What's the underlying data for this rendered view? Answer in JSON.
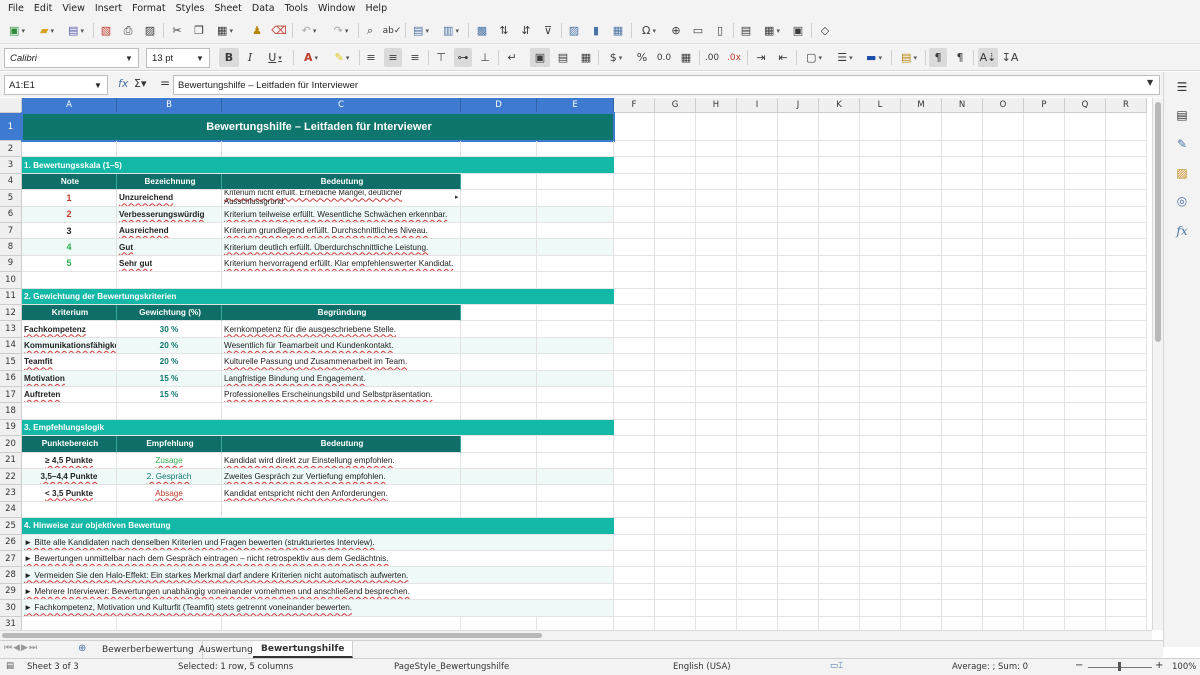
{
  "menu": [
    "File",
    "Edit",
    "View",
    "Insert",
    "Format",
    "Styles",
    "Sheet",
    "Data",
    "Tools",
    "Window",
    "Help"
  ],
  "font": {
    "name": "Calibri",
    "size": "13 pt"
  },
  "namebox": "A1:E1",
  "formula": "Bewertungshilfe – Leitfaden für Interviewer",
  "columns": [
    "A",
    "B",
    "C",
    "D",
    "E",
    "F",
    "G",
    "H",
    "I",
    "J",
    "K",
    "L",
    "M",
    "N",
    "O",
    "P",
    "Q",
    "R"
  ],
  "rows": [
    "1",
    "2",
    "3",
    "4",
    "5",
    "6",
    "7",
    "8",
    "9",
    "10",
    "11",
    "12",
    "13",
    "14",
    "15",
    "16",
    "17",
    "18",
    "19",
    "20",
    "21",
    "22",
    "23",
    "24",
    "25",
    "26",
    "27",
    "28",
    "29",
    "30",
    "31"
  ],
  "sheet": {
    "title": "Bewertungshilfe – Leitfaden für Interviewer",
    "s1": {
      "header": "1. Bewertungsskala (1–5)",
      "cols": [
        "Note",
        "Bezeichnung",
        "Bedeutung"
      ],
      "rows": [
        {
          "note": "1",
          "label": "Unzureichend",
          "desc": "Kriterium nicht erfüllt. Erhebliche Mängel, deutlicher Ausschlussgrund.",
          "color": "#c0392b"
        },
        {
          "note": "2",
          "label": "Verbesserungswürdig",
          "desc": "Kriterium teilweise erfüllt. Wesentliche Schwächen erkennbar.",
          "color": "#c0392b"
        },
        {
          "note": "3",
          "label": "Ausreichend",
          "desc": "Kriterium grundlegend erfüllt. Durchschnittliches Niveau.",
          "color": "#222222"
        },
        {
          "note": "4",
          "label": "Gut",
          "desc": "Kriterium deutlich erfüllt. Überdurchschnittliche Leistung.",
          "color": "#2fae4e"
        },
        {
          "note": "5",
          "label": "Sehr gut",
          "desc": "Kriterium hervorragend erfüllt. Klar empfehlenswerter Kandidat.",
          "color": "#2fae4e"
        }
      ]
    },
    "s2": {
      "header": "2. Gewichtung der Bewertungskriterien",
      "cols": [
        "Kriterium",
        "Gewichtung (%)",
        "Begründung"
      ],
      "rows": [
        {
          "k": "Fachkompetenz",
          "w": "30 %",
          "b": "Kernkompetenz für die ausgeschriebene Stelle."
        },
        {
          "k": "Kommunikationsfähigkeit",
          "w": "20 %",
          "b": "Wesentlich für Teamarbeit und Kundenkontakt."
        },
        {
          "k": "Teamfit",
          "w": "20 %",
          "b": "Kulturelle Passung und Zusammenarbeit im Team."
        },
        {
          "k": "Motivation",
          "w": "15 %",
          "b": "Langfristige Bindung und Engagement."
        },
        {
          "k": "Auftreten",
          "w": "15 %",
          "b": "Professionelles Erscheinungsbild und Selbstpräsentation."
        }
      ]
    },
    "s3": {
      "header": "3. Empfehlungslogik",
      "cols": [
        "Punktebereich",
        "Empfehlung",
        "Bedeutung"
      ],
      "rows": [
        {
          "p": "≥ 4,5 Punkte",
          "e": "Zusage",
          "b": "Kandidat wird direkt zur Einstellung empfohlen.",
          "color": "#2fae4e"
        },
        {
          "p": "3,5–4,4 Punkte",
          "e": "2. Gespräch",
          "b": "Zweites Gespräch zur Vertiefung empfohlen.",
          "color": "#0f766e"
        },
        {
          "p": "< 3,5 Punkte",
          "e": "Absage",
          "b": "Kandidat entspricht nicht den Anforderungen.",
          "color": "#c0392b"
        }
      ]
    },
    "s4": {
      "header": "4. Hinweise zur objektiven Bewertung",
      "items": [
        "► Bitte alle Kandidaten nach denselben Kriterien und Fragen bewerten (strukturiertes Interview).",
        "► Bewertungen unmittelbar nach dem Gespräch eintragen – nicht retrospektiv aus dem Gedächtnis.",
        "► Vermeiden Sie den Halo-Effekt: Ein starkes Merkmal darf andere Kriterien nicht automatisch aufwerten.",
        "► Mehrere Interviewer: Bewertungen unabhängig voneinander vornehmen und anschließend besprechen.",
        "► Fachkompetenz, Motivation und Kulturfit (Teamfit) stets getrennt voneinander bewerten."
      ]
    }
  },
  "tabs": [
    "Bewerberbewertung",
    "Auswertung",
    "Bewertungshilfe"
  ],
  "status": {
    "sheet": "Sheet 3 of 3",
    "selected": "Selected: 1 row, 5 columns",
    "pagestyle": "PageStyle_Bewertungshilfe",
    "lang": "English (USA)",
    "sum": "Average: ; Sum: 0",
    "zoom": "100%"
  },
  "colors": {
    "title": "#0f766e",
    "section": "#14b8a6",
    "header": "#0f6e67",
    "alt": "#eef9f8",
    "selection": "#3e7bd0"
  }
}
